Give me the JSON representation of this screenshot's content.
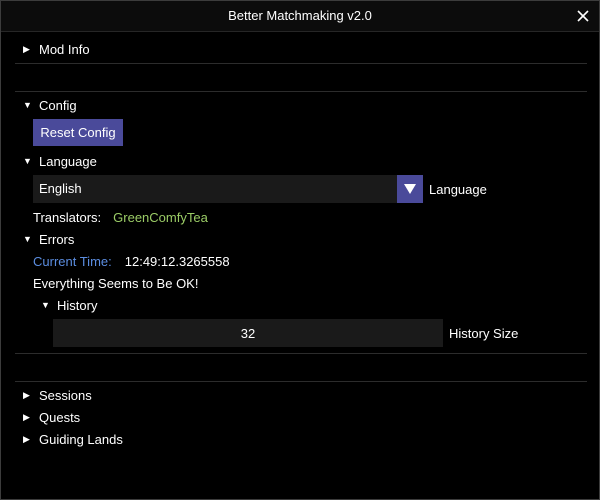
{
  "window": {
    "title": "Better Matchmaking v2.0",
    "close_icon": "close-icon"
  },
  "mod_info": {
    "label": "Mod Info",
    "collapsed": true
  },
  "config": {
    "label": "Config",
    "expanded": true,
    "reset_button": "Reset Config"
  },
  "language": {
    "label": "Language",
    "expanded": true,
    "selected": "English",
    "combo_label": "Language",
    "translators_label": "Translators:",
    "translators_value": "GreenComfyTea"
  },
  "errors": {
    "label": "Errors",
    "expanded": true,
    "current_time_label": "Current Time:",
    "current_time_value": "12:49:12.3265558",
    "status": "Everything Seems to Be OK!",
    "history": {
      "label": "History",
      "expanded": true,
      "size_value": "32",
      "size_label": "History Size"
    }
  },
  "sections": [
    {
      "label": "Sessions"
    },
    {
      "label": "Quests"
    },
    {
      "label": "Guiding Lands"
    }
  ],
  "colors": {
    "button": "#4a4a9a",
    "translator": "#9bcc66",
    "current_time_label": "#5b8de0",
    "frame_bg": "#1a1a1a"
  }
}
